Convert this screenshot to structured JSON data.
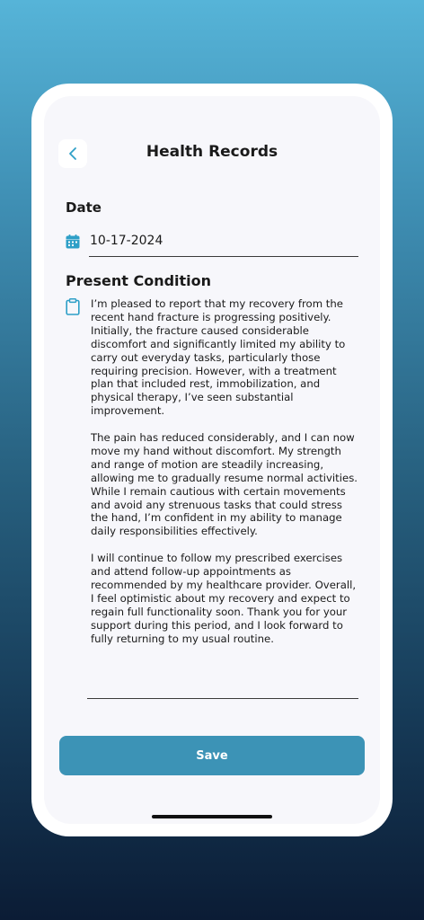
{
  "header": {
    "title": "Health Records",
    "back_icon": "chevron-left-icon"
  },
  "date": {
    "label": "Date",
    "value": "10-17-2024",
    "icon": "calendar-icon"
  },
  "condition": {
    "label": "Present Condition",
    "icon": "clipboard-icon",
    "paragraphs": [
      "I’m pleased to report that my recovery from the recent hand fracture is progressing positively. Initially, the fracture caused considerable discomfort and significantly limited my ability to carry out everyday tasks, particularly those requiring precision. However, with a treatment plan that included rest, immobilization, and physical therapy, I’ve seen substantial improvement.",
      "The pain has reduced considerably, and I can now move my hand without discomfort. My strength and range of motion are steadily increasing, allowing me to gradually resume normal activities. While I remain cautious with certain movements and avoid any strenuous tasks that could stress the hand, I’m confident in my ability to manage daily responsibilities effectively.",
      "I will continue to follow my prescribed exercises and attend follow-up appointments as recommended by my healthcare provider. Overall, I feel optimistic about my recovery and expect to regain full functionality soon. Thank you for your support during this period, and I look forward to fully returning to my usual routine."
    ]
  },
  "actions": {
    "save_label": "Save"
  },
  "colors": {
    "accent": "#3c93b6",
    "icon": "#2e9fc7"
  }
}
